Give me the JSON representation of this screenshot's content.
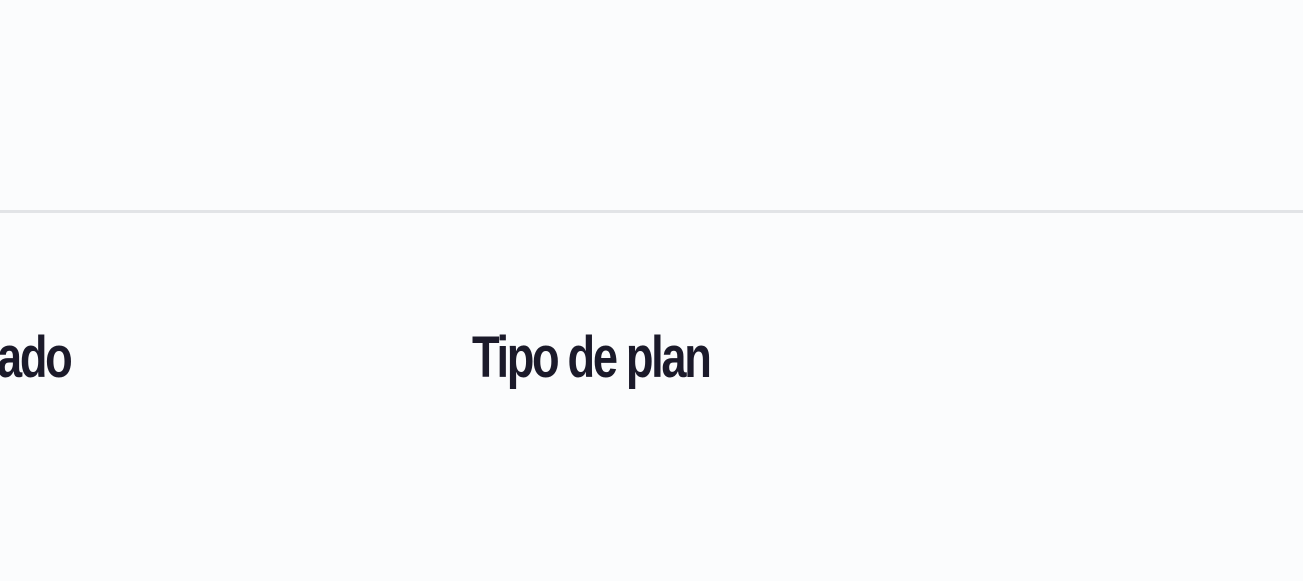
{
  "table": {
    "columns": [
      {
        "label": "ado"
      },
      {
        "label": "Tipo de plan"
      }
    ]
  },
  "colors": {
    "background": "#fbfcfd",
    "divider": "#e2e4e7",
    "header_text": "#1b1a2a"
  }
}
